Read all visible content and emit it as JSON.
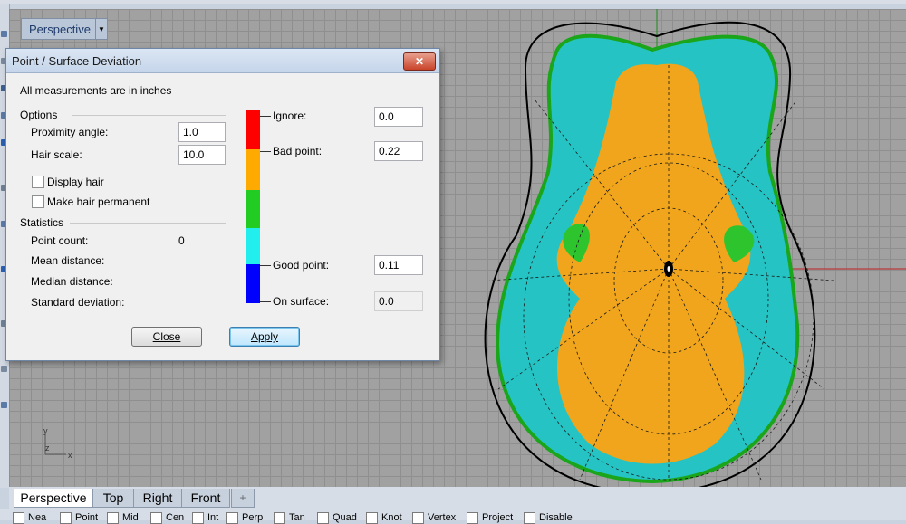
{
  "viewport": {
    "title": "Perspective",
    "axis": {
      "x": "x",
      "y": "y",
      "z": "z"
    }
  },
  "dialog": {
    "title": "Point / Surface Deviation",
    "close_glyph": "✕",
    "units_note": "All measurements are in inches",
    "options_header": "Options",
    "proximity_label": "Proximity angle:",
    "proximity_value": "1.0",
    "hair_scale_label": "Hair scale:",
    "hair_scale_value": "10.0",
    "display_hair_label": "Display hair",
    "display_hair_checked": false,
    "make_permanent_label": "Make hair permanent",
    "make_permanent_checked": false,
    "statistics_header": "Statistics",
    "point_count_label": "Point count:",
    "point_count_value": "0",
    "mean_label": "Mean distance:",
    "median_label": "Median distance:",
    "stddev_label": "Standard deviation:",
    "ignore_label": "Ignore:",
    "ignore_value": "0.0",
    "bad_point_label": "Bad point:",
    "bad_point_value": "0.22",
    "good_point_label": "Good point:",
    "good_point_value": "0.11",
    "on_surface_label": "On surface:",
    "on_surface_value": "0.0",
    "close_button": "Close",
    "apply_button": "Apply",
    "color_scale": [
      "#ff0000",
      "#ffaa00",
      "#22cc22",
      "#22eeee",
      "#0000ff"
    ]
  },
  "tabs": [
    "Perspective",
    "Top",
    "Right",
    "Front",
    "+"
  ],
  "osnaps": [
    "Nea",
    "Point",
    "Mid",
    "Cen",
    "Int",
    "Perp",
    "Tan",
    "Quad",
    "Knot",
    "Vertex",
    "Project",
    "Disable"
  ],
  "colors": {
    "viewport_bg": "#a1a1a1",
    "dialog_bg": "#f0f0f0",
    "title_bar": "#c5d5ea"
  }
}
